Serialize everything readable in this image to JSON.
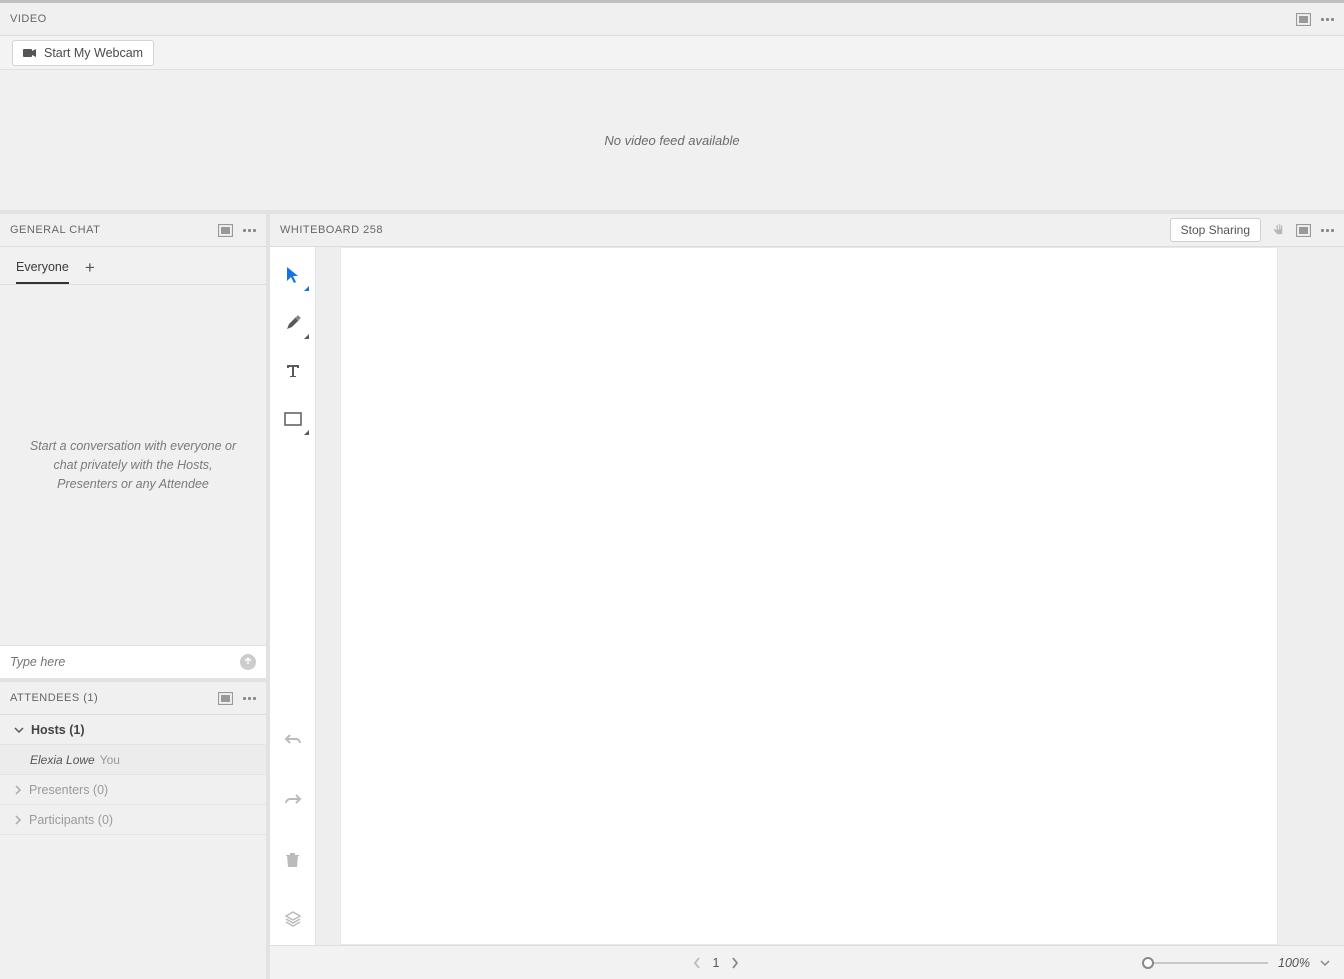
{
  "video": {
    "title": "VIDEO",
    "start_webcam": "Start My Webcam",
    "no_feed": "No video feed available"
  },
  "chat": {
    "title": "GENERAL CHAT",
    "tabs": {
      "everyone": "Everyone"
    },
    "placeholder_block": "Start a conversation with everyone or chat privately with the Hosts, Presenters or any Attendee",
    "input_placeholder": "Type here"
  },
  "attendees": {
    "title": "ATTENDEES",
    "count": "(1)",
    "groups": {
      "hosts_label": "Hosts (1)",
      "presenters_label": "Presenters (0)",
      "participants_label": "Participants (0)"
    },
    "me_name": "Elexia Lowe",
    "me_suffix": "You"
  },
  "whiteboard": {
    "title": "WHITEBOARD 258",
    "stop_sharing": "Stop Sharing",
    "page": "1",
    "zoom": "100%"
  },
  "icons": {
    "fullscreen": "fullscreen-icon",
    "more": "more-icon",
    "webcam": "webcam-icon",
    "plus": "+",
    "send": "send-icon",
    "hand": "hand-icon",
    "pointer": "pointer-tool",
    "marker": "marker-tool",
    "text": "text-tool",
    "rect": "rectangle-tool",
    "undo": "undo-icon",
    "redo": "redo-icon",
    "trash": "trash-icon",
    "layers": "layers-icon"
  }
}
